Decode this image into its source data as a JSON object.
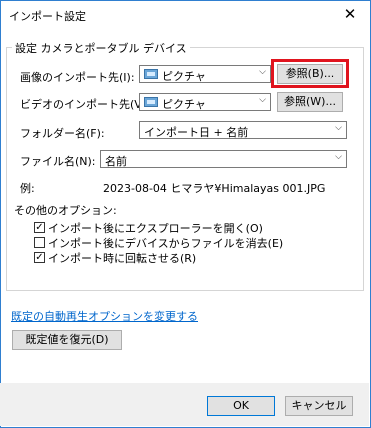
{
  "window": {
    "title": "インポート設定",
    "close_glyph": "✕"
  },
  "group": {
    "legend": "設定 カメラとポータブル デバイス"
  },
  "image_import": {
    "label": "画像のインポート先(I):",
    "value": "ピクチャ",
    "browse_label": "参照(B)..."
  },
  "video_import": {
    "label": "ビデオのインポート先(V):",
    "value": "ピクチャ",
    "browse_label": "参照(W)..."
  },
  "folder_name": {
    "label": "フォルダー名(F):",
    "value": "インポート日 + 名前"
  },
  "file_name": {
    "label": "ファイル名(N):",
    "value": "名前"
  },
  "example": {
    "label": "例:",
    "value": "2023-08-04 ヒマラヤ¥Himalayas 001.JPG"
  },
  "other_options": {
    "label": "その他のオプション:",
    "items": [
      {
        "label": "インポート後にエクスプローラーを開く(O)",
        "checked": true
      },
      {
        "label": "インポート後にデバイスからファイルを消去(E)",
        "checked": false
      },
      {
        "label": "インポート時に回転させる(R)",
        "checked": true
      }
    ]
  },
  "autoplay_link": "既定の自動再生オプションを変更する",
  "restore_defaults_label": "既定値を復元(D)",
  "ok_label": "OK",
  "cancel_label": "キャンセル",
  "icons": {
    "dropdown": "chevron-down-icon",
    "folder": "pictures-folder-icon",
    "check": "checkmark-icon"
  },
  "colors": {
    "highlight": "#e0141e",
    "link": "#0066cc",
    "accent": "#0078d7"
  }
}
